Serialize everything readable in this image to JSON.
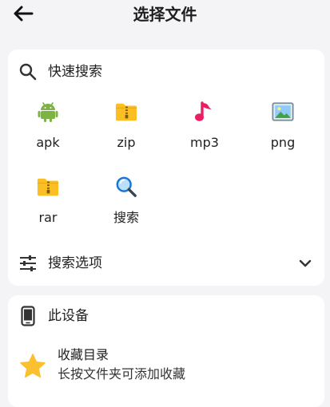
{
  "header": {
    "title": "选择文件"
  },
  "quick_search": {
    "title": "快速搜索",
    "items": [
      {
        "label": "apk",
        "icon": "android-icon"
      },
      {
        "label": "zip",
        "icon": "zip-folder-icon"
      },
      {
        "label": "mp3",
        "icon": "music-note-icon"
      },
      {
        "label": "png",
        "icon": "image-icon"
      },
      {
        "label": "rar",
        "icon": "rar-folder-icon"
      },
      {
        "label": "搜索",
        "icon": "magnifier-icon"
      }
    ]
  },
  "search_options": {
    "label": "搜索选项"
  },
  "device": {
    "title": "此设备",
    "favorites": {
      "title": "收藏目录",
      "subtitle": "长按文件夹可添加收藏"
    }
  },
  "colors": {
    "background": "#f4f4f6",
    "card": "#ffffff",
    "android_green": "#7cb342",
    "folder_yellow": "#fbbf24",
    "music_pink": "#e91e63",
    "star_yellow": "#fbc02d",
    "search_blue": "#2196f3"
  }
}
